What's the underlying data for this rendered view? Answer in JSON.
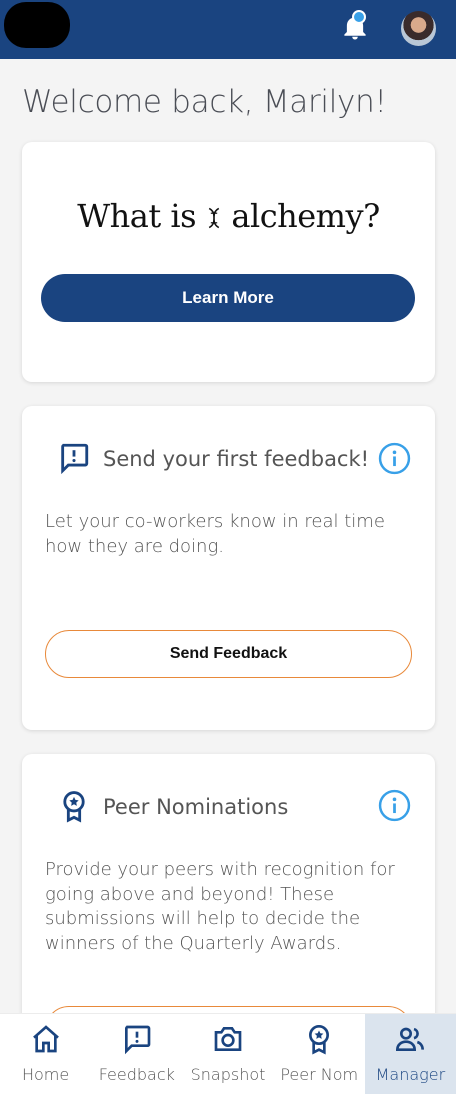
{
  "welcome": {
    "text": "Welcome back, Marilyn!"
  },
  "alchemy_card": {
    "title": "What is ס alchemy?",
    "title_pre": "What is",
    "title_post": "alchemy?",
    "button_label": "Learn More"
  },
  "feedback_card": {
    "title": "Send your first feedback!",
    "body": "Let your co-workers know in real time how they are doing.",
    "button_label": "Send Feedback",
    "icon": "message-alert-icon"
  },
  "nominations_card": {
    "title": "Peer Nominations",
    "body": "Provide your peers with recognition for going above and beyond! These submissions will help to decide the winners of the Quarterly Awards.",
    "icon": "award-badge-icon"
  },
  "tabs": [
    {
      "label": "Home",
      "icon": "home-icon"
    },
    {
      "label": "Feedback",
      "icon": "feedback-icon"
    },
    {
      "label": "Snapshot",
      "icon": "camera-icon"
    },
    {
      "label": "Peer Nom",
      "icon": "award-icon"
    },
    {
      "label": "Manager",
      "icon": "people-icon",
      "active": true
    }
  ],
  "colors": {
    "primary": "#1a4480",
    "accent_orange": "#e8893a",
    "info_blue": "#38a0e8",
    "background": "#f4f4f4"
  }
}
